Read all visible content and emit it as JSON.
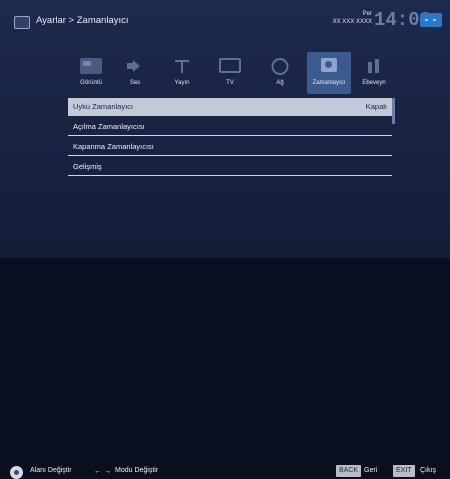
{
  "header": {
    "breadcrumb": "Ayarlar > Zamanlayıcı",
    "date_day": "Per",
    "date_date": "XX XXX XXXX",
    "clock": "14:00"
  },
  "categories": [
    {
      "label": "Görüntü",
      "icon": "picture-icon"
    },
    {
      "label": "Ses",
      "icon": "speaker-icon"
    },
    {
      "label": "Yayın",
      "icon": "antenna-icon"
    },
    {
      "label": "TV",
      "icon": "tv-icon"
    },
    {
      "label": "Ağ",
      "icon": "network-icon"
    },
    {
      "label": "Zamanlayıcı",
      "icon": "timer-icon",
      "active": true
    },
    {
      "label": "Ebeveyn",
      "icon": "parental-icon"
    }
  ],
  "menu": [
    {
      "label": "Uyku Zamanlayıcı",
      "value": "Kapalı",
      "selected": true
    },
    {
      "label": "Açılma Zamanlayıcısı",
      "value": ""
    },
    {
      "label": "Kapanma Zamanlayıcısı",
      "value": ""
    },
    {
      "label": "Gelişmiş",
      "value": ""
    }
  ],
  "footer": {
    "nav_label": "Alanı Değiştir",
    "mode_arrows": "← →",
    "mode_label": "Modu Değiştir",
    "back_key": "BACK",
    "back_label": "Geri",
    "exit_key": "EXIT",
    "exit_label": "Çıkış"
  },
  "colors": {
    "background": "#1a2544",
    "selected_row": "#c3c9d6",
    "active_tab": "#3b5b8e",
    "clock_accent": "#2a78cc"
  }
}
